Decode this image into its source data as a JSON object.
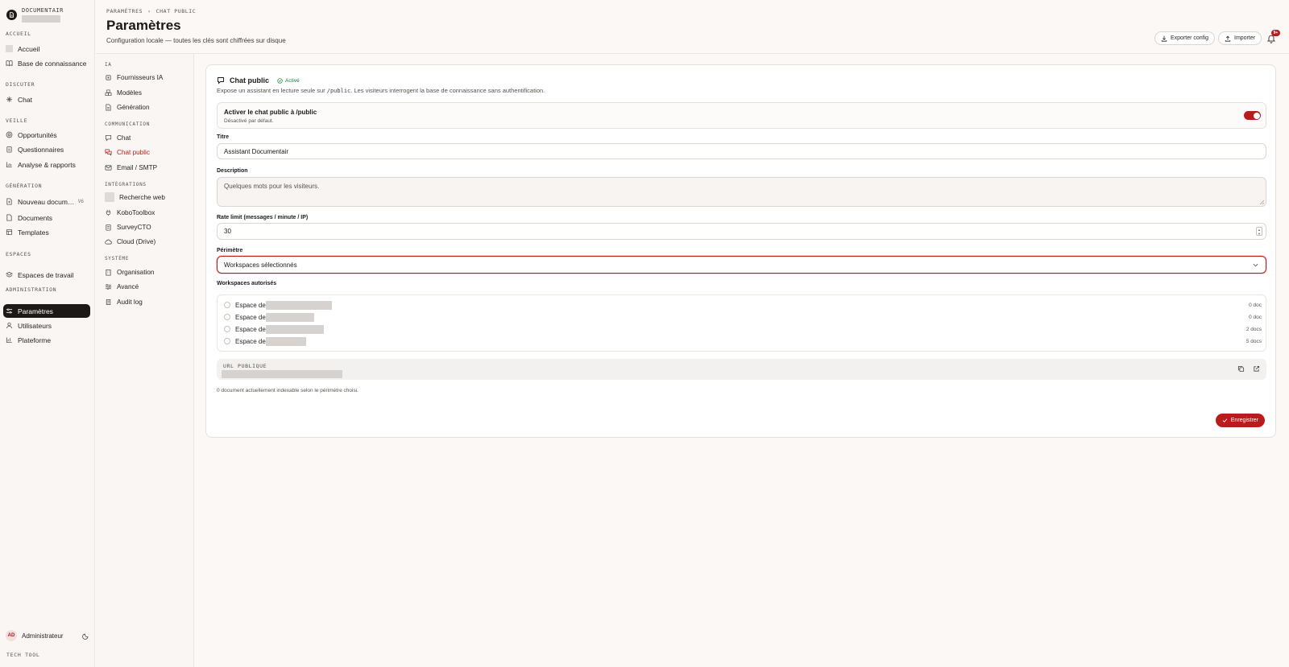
{
  "brand": {
    "name": "DOCUMENTAIR"
  },
  "sidebar": {
    "sections": {
      "accueil": "ACCUEIL",
      "discuter": "DISCUTER",
      "veille": "VEILLE",
      "generation": "GÉNÉRATION",
      "espaces": "ESPACES",
      "administration": "ADMINISTRATION"
    },
    "items": {
      "accueil": "Accueil",
      "base": "Base de connaissance",
      "chat": "Chat",
      "opportunites": "Opportunités",
      "questionnaires": "Questionnaires",
      "analyse": "Analyse & rapports",
      "nouveau": "Nouveau docum…",
      "nouveau_badge": "V6",
      "documents": "Documents",
      "templates": "Templates",
      "espaces_travail": "Espaces de travail",
      "parametres": "Paramètres",
      "utilisateurs": "Utilisateurs",
      "plateforme": "Plateforme"
    },
    "user": {
      "initials": "AD",
      "name": "Administrateur"
    },
    "footer": "TECH TOOL"
  },
  "header": {
    "breadcrumb": [
      "PARAMÈTRES",
      "›",
      "CHAT PUBLIC"
    ],
    "title": "Paramètres",
    "subtitle": "Configuration locale — toutes les clés sont chiffrées sur disque",
    "export_label": "Exporter config",
    "import_label": "Importer",
    "notif_count": "9+"
  },
  "subnav": {
    "sections": {
      "ia": "IA",
      "communication": "COMMUNICATION",
      "integrations": "INTÉGRATIONS",
      "systeme": "SYSTÈME"
    },
    "items": {
      "fournisseurs": "Fournisseurs IA",
      "modeles": "Modèles",
      "generation": "Génération",
      "chat": "Chat",
      "chat_public": "Chat public",
      "email": "Email / SMTP",
      "recherche": "Recherche web",
      "kobo": "KoboToolbox",
      "surveycto": "SurveyCTO",
      "cloud": "Cloud (Drive)",
      "organisation": "Organisation",
      "avance": "Avancé",
      "audit": "Audit log"
    }
  },
  "card": {
    "title": "Chat public",
    "status": "Activé",
    "desc_before": "Expose un assistant en lecture seule sur ",
    "desc_code": "/public",
    "desc_after": ". Les visiteurs interrogent la base de connaissance sans authentification.",
    "toggle_label": "Activer le chat public à /public",
    "toggle_sub": "Désactivé par défaut.",
    "toggle_on": true,
    "titre_label": "Titre",
    "titre_value": "Assistant Documentair",
    "description_label": "Description",
    "description_placeholder": "Quelques mots pour les visiteurs.",
    "rate_label": "Rate limit (messages / minute / IP)",
    "rate_value": "30",
    "perimetre_label": "Périmètre",
    "perimetre_value": "Workspaces sélectionnés",
    "workspaces_label": "Workspaces autorisés",
    "workspaces": [
      {
        "prefix": "Espace de",
        "count": "0 doc"
      },
      {
        "prefix": "Espace de",
        "count": "0 doc"
      },
      {
        "prefix": "Espace de",
        "count": "2 docs"
      },
      {
        "prefix": "Espace de",
        "count": "5 docs"
      }
    ],
    "url_label": "URL PUBLIQUE",
    "footnote": "0 document actuellement indexable selon le périmètre choisi.",
    "save_label": "Enregistrer"
  },
  "colors": {
    "accent": "#b91c1c",
    "active_nav": "#1c1917",
    "success": "#15803d"
  }
}
